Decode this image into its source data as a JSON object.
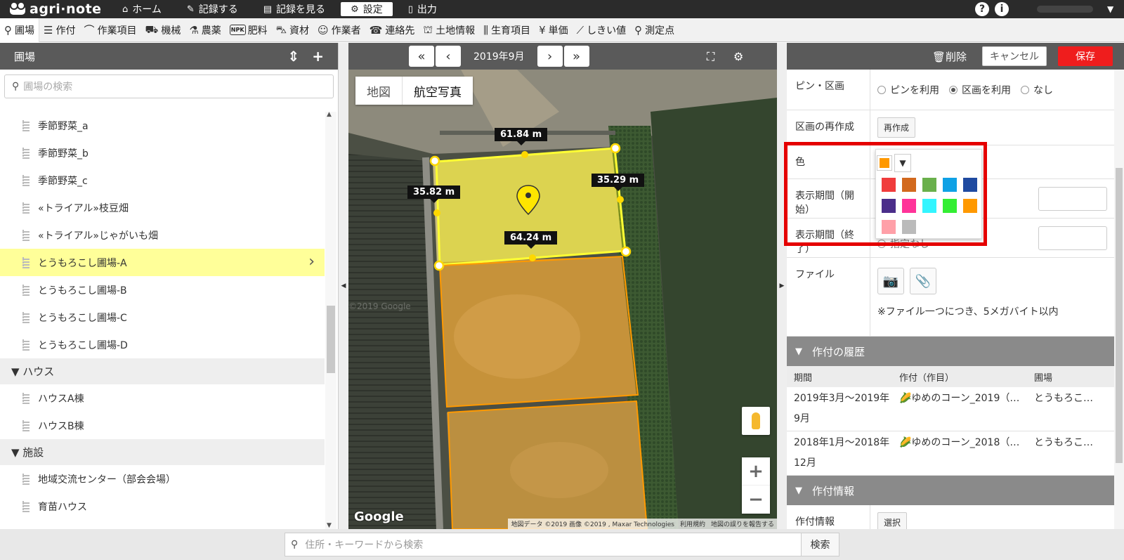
{
  "app": {
    "name": "agri·note"
  },
  "topnav": [
    {
      "label": "ホーム",
      "icon": "home-icon",
      "glyph": "⌂"
    },
    {
      "label": "記録する",
      "icon": "pencil-icon",
      "glyph": "✎"
    },
    {
      "label": "記録を見る",
      "icon": "notebook-icon",
      "glyph": "▤"
    },
    {
      "label": "設定",
      "icon": "gear-icon",
      "glyph": "⚙"
    },
    {
      "label": "出力",
      "icon": "document-icon",
      "glyph": "▯"
    }
  ],
  "topnav_active": "設定",
  "subnav": [
    {
      "label": "圃場",
      "icon": "location-pin-icon",
      "glyph": "⚲"
    },
    {
      "label": "作付",
      "icon": "list-icon",
      "glyph": "☰"
    },
    {
      "label": "作業項目",
      "icon": "scythe-icon",
      "glyph": "⌒"
    },
    {
      "label": "機械",
      "icon": "tractor-icon",
      "glyph": "⛟"
    },
    {
      "label": "農薬",
      "icon": "flask-icon",
      "glyph": "⚗"
    },
    {
      "label": "肥料",
      "icon": "npk-icon",
      "glyph": "NPK"
    },
    {
      "label": "資材",
      "icon": "wheelbarrow-icon",
      "glyph": "⛍"
    },
    {
      "label": "作業者",
      "icon": "person-icon",
      "glyph": "☺"
    },
    {
      "label": "連絡先",
      "icon": "phone-icon",
      "glyph": "☎"
    },
    {
      "label": "土地情報",
      "icon": "survey-icon",
      "glyph": "⛫"
    },
    {
      "label": "生育項目",
      "icon": "growth-icon",
      "glyph": "⫼"
    },
    {
      "label": "単価",
      "icon": "yen-icon",
      "glyph": "¥"
    },
    {
      "label": "しきい値",
      "icon": "threshold-chart-icon",
      "glyph": "⟋"
    },
    {
      "label": "測定点",
      "icon": "marker-icon",
      "glyph": "⚲"
    }
  ],
  "left": {
    "title": "圃場",
    "search_placeholder": "圃場の検索",
    "items": [
      {
        "type": "item",
        "label": "季節野菜_a"
      },
      {
        "type": "item",
        "label": "季節野菜_b"
      },
      {
        "type": "item",
        "label": "季節野菜_c"
      },
      {
        "type": "item",
        "label": "«トライアル»枝豆畑"
      },
      {
        "type": "item",
        "label": "«トライアル»じゃがいも畑"
      },
      {
        "type": "item",
        "label": "とうもろこし圃場-A",
        "selected": true
      },
      {
        "type": "item",
        "label": "とうもろこし圃場-B"
      },
      {
        "type": "item",
        "label": "とうもろこし圃場-C"
      },
      {
        "type": "item",
        "label": "とうもろこし圃場-D"
      },
      {
        "type": "group",
        "label": "▼ ハウス"
      },
      {
        "type": "item",
        "label": "ハウスA棟"
      },
      {
        "type": "item",
        "label": "ハウスB棟"
      },
      {
        "type": "group",
        "label": "▼ 施設"
      },
      {
        "type": "item",
        "label": "地域交流センター（部会会場）"
      },
      {
        "type": "item",
        "label": "育苗ハウス"
      }
    ]
  },
  "map": {
    "date": "2019年9月",
    "toggle": [
      "地図",
      "航空写真"
    ],
    "measures": [
      "61.84 m",
      "35.82 m",
      "35.29 m",
      "64.24 m"
    ],
    "watermark": "©2019 Google",
    "google": "Google",
    "attribution": [
      "地図データ ©2019 画像 ©2019 , Maxar Technologies",
      "利用規約",
      "地図の誤りを報告する"
    ]
  },
  "right": {
    "delete_label": "削除",
    "cancel_label": "キャンセル",
    "save_label": "保存",
    "pin_label": "ピン・区画",
    "pin_options": [
      "ピンを利用",
      "区画を利用",
      "なし"
    ],
    "pin_selected": 1,
    "recreate_label": "区画の再作成",
    "recreate_btn": "再作成",
    "color_label": "色",
    "start_label": "表示期間（開始）",
    "end_label": "表示期間（終了）",
    "end_value_partial": "指定なし",
    "file_label": "ファイル",
    "file_note": "※ファイル一つにつき、5メガバイト以内",
    "history_title": "作付の履歴",
    "history_cols": [
      "期間",
      "作付（作目）",
      "圃場"
    ],
    "history_rows": [
      [
        "2019年3月～2019年9月",
        "🌽ゆめのコーン_2019（…",
        "とうもろこ…"
      ],
      [
        "2018年1月～2018年12月",
        "🌽ゆめのコーン_2018（…",
        "とうもろこ…"
      ]
    ],
    "info_title": "作付情報",
    "info_label": "作付情報",
    "info_btn": "選択"
  },
  "color_picker": {
    "selected": "#ff9900",
    "palette": [
      "#f03c3c",
      "#d2691e",
      "#6ab04c",
      "#0fa1e5",
      "#1f4aa0",
      "#4b2e8a",
      "#ff3399",
      "#33f5ff",
      "#33ee33",
      "#ff9900",
      "#ffa0a8",
      "#bbbbbb"
    ]
  },
  "bottom": {
    "placeholder": "住所・キーワードから検索",
    "button": "検索"
  }
}
